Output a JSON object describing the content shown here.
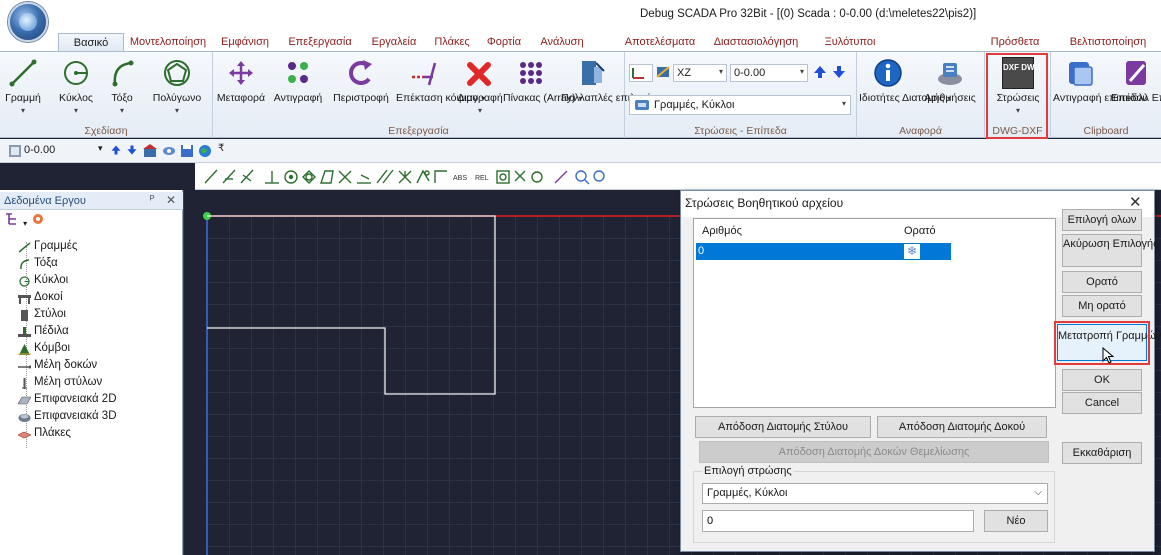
{
  "window": {
    "title": "Debug SCADA Pro 32Bit - [(0) Scada : 0-0.00 (d:\\meletes22\\pis2)]"
  },
  "ribbon_tabs": [
    {
      "label": "Βασικό",
      "active": true
    },
    {
      "label": "Μοντελοποίηση",
      "active": false
    },
    {
      "label": "Εμφάνιση",
      "active": false
    },
    {
      "label": "Επεξεργασία",
      "active": false
    },
    {
      "label": "Εργαλεία",
      "active": false
    },
    {
      "label": "Πλάκες",
      "active": false
    },
    {
      "label": "Φορτία",
      "active": false
    },
    {
      "label": "Ανάλυση",
      "active": false
    },
    {
      "label": "Αποτελέσματα",
      "active": false
    },
    {
      "label": "Διαστασιολόγηση",
      "active": false
    },
    {
      "label": "Ξυλότυποι",
      "active": false
    },
    {
      "label": "Πρόσθετα",
      "active": false
    },
    {
      "label": "Βελτιστοποίηση",
      "active": false
    }
  ],
  "ribbon": {
    "design": {
      "label": "Σχεδίαση",
      "buttons": [
        {
          "label": "Γραμμή",
          "icon": "line-icon"
        },
        {
          "label": "Κύκλος",
          "icon": "circle-icon"
        },
        {
          "label": "Τόξο",
          "icon": "arc-icon"
        },
        {
          "label": "Πολύγωνο",
          "icon": "polygon-icon"
        }
      ]
    },
    "edit": {
      "label": "Επεξεργασία",
      "buttons": [
        {
          "label": "Μεταφορά",
          "icon": "move-icon"
        },
        {
          "label": "Αντιγραφή",
          "icon": "copy-icon"
        },
        {
          "label": "Περιστροφή",
          "icon": "rotate-icon"
        },
        {
          "label": "Επέκταση κόψιμο",
          "icon": "extend-trim-icon"
        },
        {
          "label": "Διαγραφή",
          "icon": "delete-icon"
        },
        {
          "label": "Πίνακας (Array)",
          "icon": "array-icon"
        },
        {
          "label": "Πολλαπλές επιλογές",
          "icon": "multi-select-icon"
        }
      ]
    },
    "layers_plane": {
      "label": "Στρώσεις - Επίπεδα",
      "plane": "XZ",
      "level": "0-0.00",
      "layer_select": "Γραμμές, Κύκλοι"
    },
    "reference": {
      "label": "Αναφορά",
      "buttons": [
        {
          "label": "Ιδιοτήτες Διατομής",
          "icon": "info-icon"
        },
        {
          "label": "Αριθμήσεις",
          "icon": "numbering-icon"
        }
      ]
    },
    "dwg": {
      "label": "DWG-DXF",
      "buttons": [
        {
          "label": "Στρώσεις",
          "icon": "dxf-dwg-icon",
          "badge": "DXF DWG"
        }
      ]
    },
    "clipboard": {
      "label": "Clipboard",
      "buttons": [
        {
          "label": "Αντιγραφή επιπέδου",
          "icon": "copy-plane-icon"
        },
        {
          "label": "Επικόλλ Επιπέδ",
          "icon": "paste-plane-icon"
        }
      ]
    }
  },
  "qat": {
    "level": "0-0.00"
  },
  "toolstrip": {
    "abs_label": "ABS",
    "rel_label": "REL"
  },
  "project_panel": {
    "title": "Δεδομένα Εργου",
    "pin": "ᴾ",
    "close": "✕",
    "items": [
      {
        "label": "Γραμμές",
        "icon": "line-icon"
      },
      {
        "label": "Τόξα",
        "icon": "arc-icon"
      },
      {
        "label": "Κύκλοι",
        "icon": "circle-icon"
      },
      {
        "label": "Δοκοί",
        "icon": "beam-icon"
      },
      {
        "label": "Στύλοι",
        "icon": "column-icon"
      },
      {
        "label": "Πέδιλα",
        "icon": "footing-icon"
      },
      {
        "label": "Κόμβοι",
        "icon": "node-icon"
      },
      {
        "label": "Μέλη δοκών",
        "icon": "beam-member-icon"
      },
      {
        "label": "Μέλη στύλων",
        "icon": "column-member-icon"
      },
      {
        "label": "Επιφανειακά 2D",
        "icon": "surface-2d-icon"
      },
      {
        "label": "Επιφανειακά 3D",
        "icon": "surface-3d-icon"
      },
      {
        "label": "Πλάκες",
        "icon": "slab-icon"
      }
    ]
  },
  "dialog": {
    "title": "Στρώσεις Βοηθητικού αρχείου",
    "close": "✕",
    "list": {
      "columns": [
        "Αριθμός",
        "Ορατό"
      ],
      "rows": [
        {
          "number": "0",
          "visible": "❄"
        }
      ]
    },
    "buttons": {
      "select_all": "Επιλογή ολων",
      "cancel_selection": "Ακύρωση Επιλογής",
      "visible": "Ορατό",
      "not_visible": "Μη ορατό",
      "convert_arcs": "Μετατροπή Γραμμών Τόξων",
      "ok": "OK",
      "cancel": "Cancel",
      "clear": "Εκκαθάριση",
      "assign_column": "Απόδοση Διατομής Στύλου",
      "assign_beam": "Απόδοση Διατομής Δοκού",
      "assign_foundation_beam": "Απόδοση Διατομής Δοκών Θεμελίωσης",
      "new": "Νέο"
    },
    "layer_group": {
      "legend": "Επιλογή στρώσης",
      "selected": "Γραμμές, Κύκλοι",
      "input_value": "0"
    }
  },
  "colors": {
    "canvas_bg": "#1f2333",
    "grid": "#3a4055",
    "highlight": "#e23b3b",
    "selection": "#0078d7"
  }
}
